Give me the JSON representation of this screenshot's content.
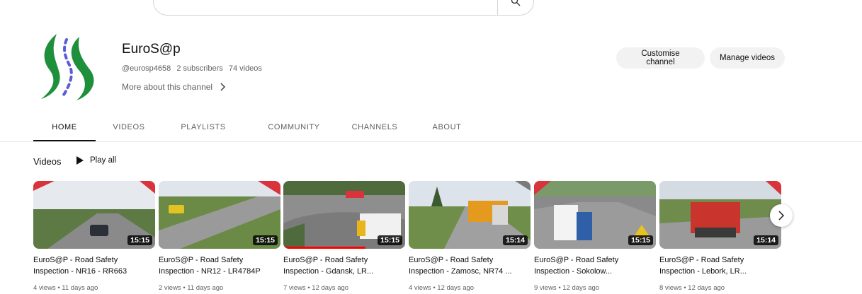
{
  "channel": {
    "name": "EuroS@p",
    "handle": "@eurosp4658",
    "subscribers": "2 subscribers",
    "video_count": "74 videos",
    "more_about": "More about this channel"
  },
  "actions": {
    "customise": "Customise channel",
    "manage": "Manage videos"
  },
  "tabs": [
    {
      "label": "HOME",
      "active": true
    },
    {
      "label": "VIDEOS",
      "active": false
    },
    {
      "label": "PLAYLISTS",
      "active": false
    },
    {
      "label": "COMMUNITY",
      "active": false
    },
    {
      "label": "CHANNELS",
      "active": false
    },
    {
      "label": "ABOUT",
      "active": false
    }
  ],
  "section": {
    "title": "Videos",
    "play_all": "Play all"
  },
  "videos": [
    {
      "title_line1": "EuroS@P - Road Safety",
      "title_line2": "Inspection - NR16 - RR663",
      "duration": "15:15",
      "meta": "4 views • 11 days ago",
      "watched": false
    },
    {
      "title_line1": "EuroS@P - Road Safety",
      "title_line2": "Inspection - NR12 - LR4784P",
      "duration": "15:15",
      "meta": "2 views • 11 days ago",
      "watched": false
    },
    {
      "title_line1": "EuroS@P - Road Safety",
      "title_line2": "Inspection - Gdansk, LR...",
      "duration": "15:15",
      "meta": "7 views • 12 days ago",
      "watched": true
    },
    {
      "title_line1": "EuroS@P - Road Safety",
      "title_line2": "Inspection - Zamosc, NR74 ...",
      "duration": "15:14",
      "meta": "4 views • 12 days ago",
      "watched": false
    },
    {
      "title_line1": "EuroS@P - Road Safety",
      "title_line2": "Inspection - Sokolow...",
      "duration": "15:15",
      "meta": "9 views • 12 days ago",
      "watched": false
    },
    {
      "title_line1": "EuroS@P - Road Safety",
      "title_line2": "Inspection - Lebork, LR...",
      "duration": "15:14",
      "meta": "8 views • 12 days ago",
      "watched": false
    }
  ],
  "colors": {
    "logo_green": "#1e8f3a",
    "logo_blue": "#5b5bd6",
    "watched_bar": "#ff0000"
  },
  "icons": {
    "search": "search-icon",
    "chevron": "chevron-right-icon",
    "play": "play-icon",
    "next": "next-arrow-icon"
  }
}
